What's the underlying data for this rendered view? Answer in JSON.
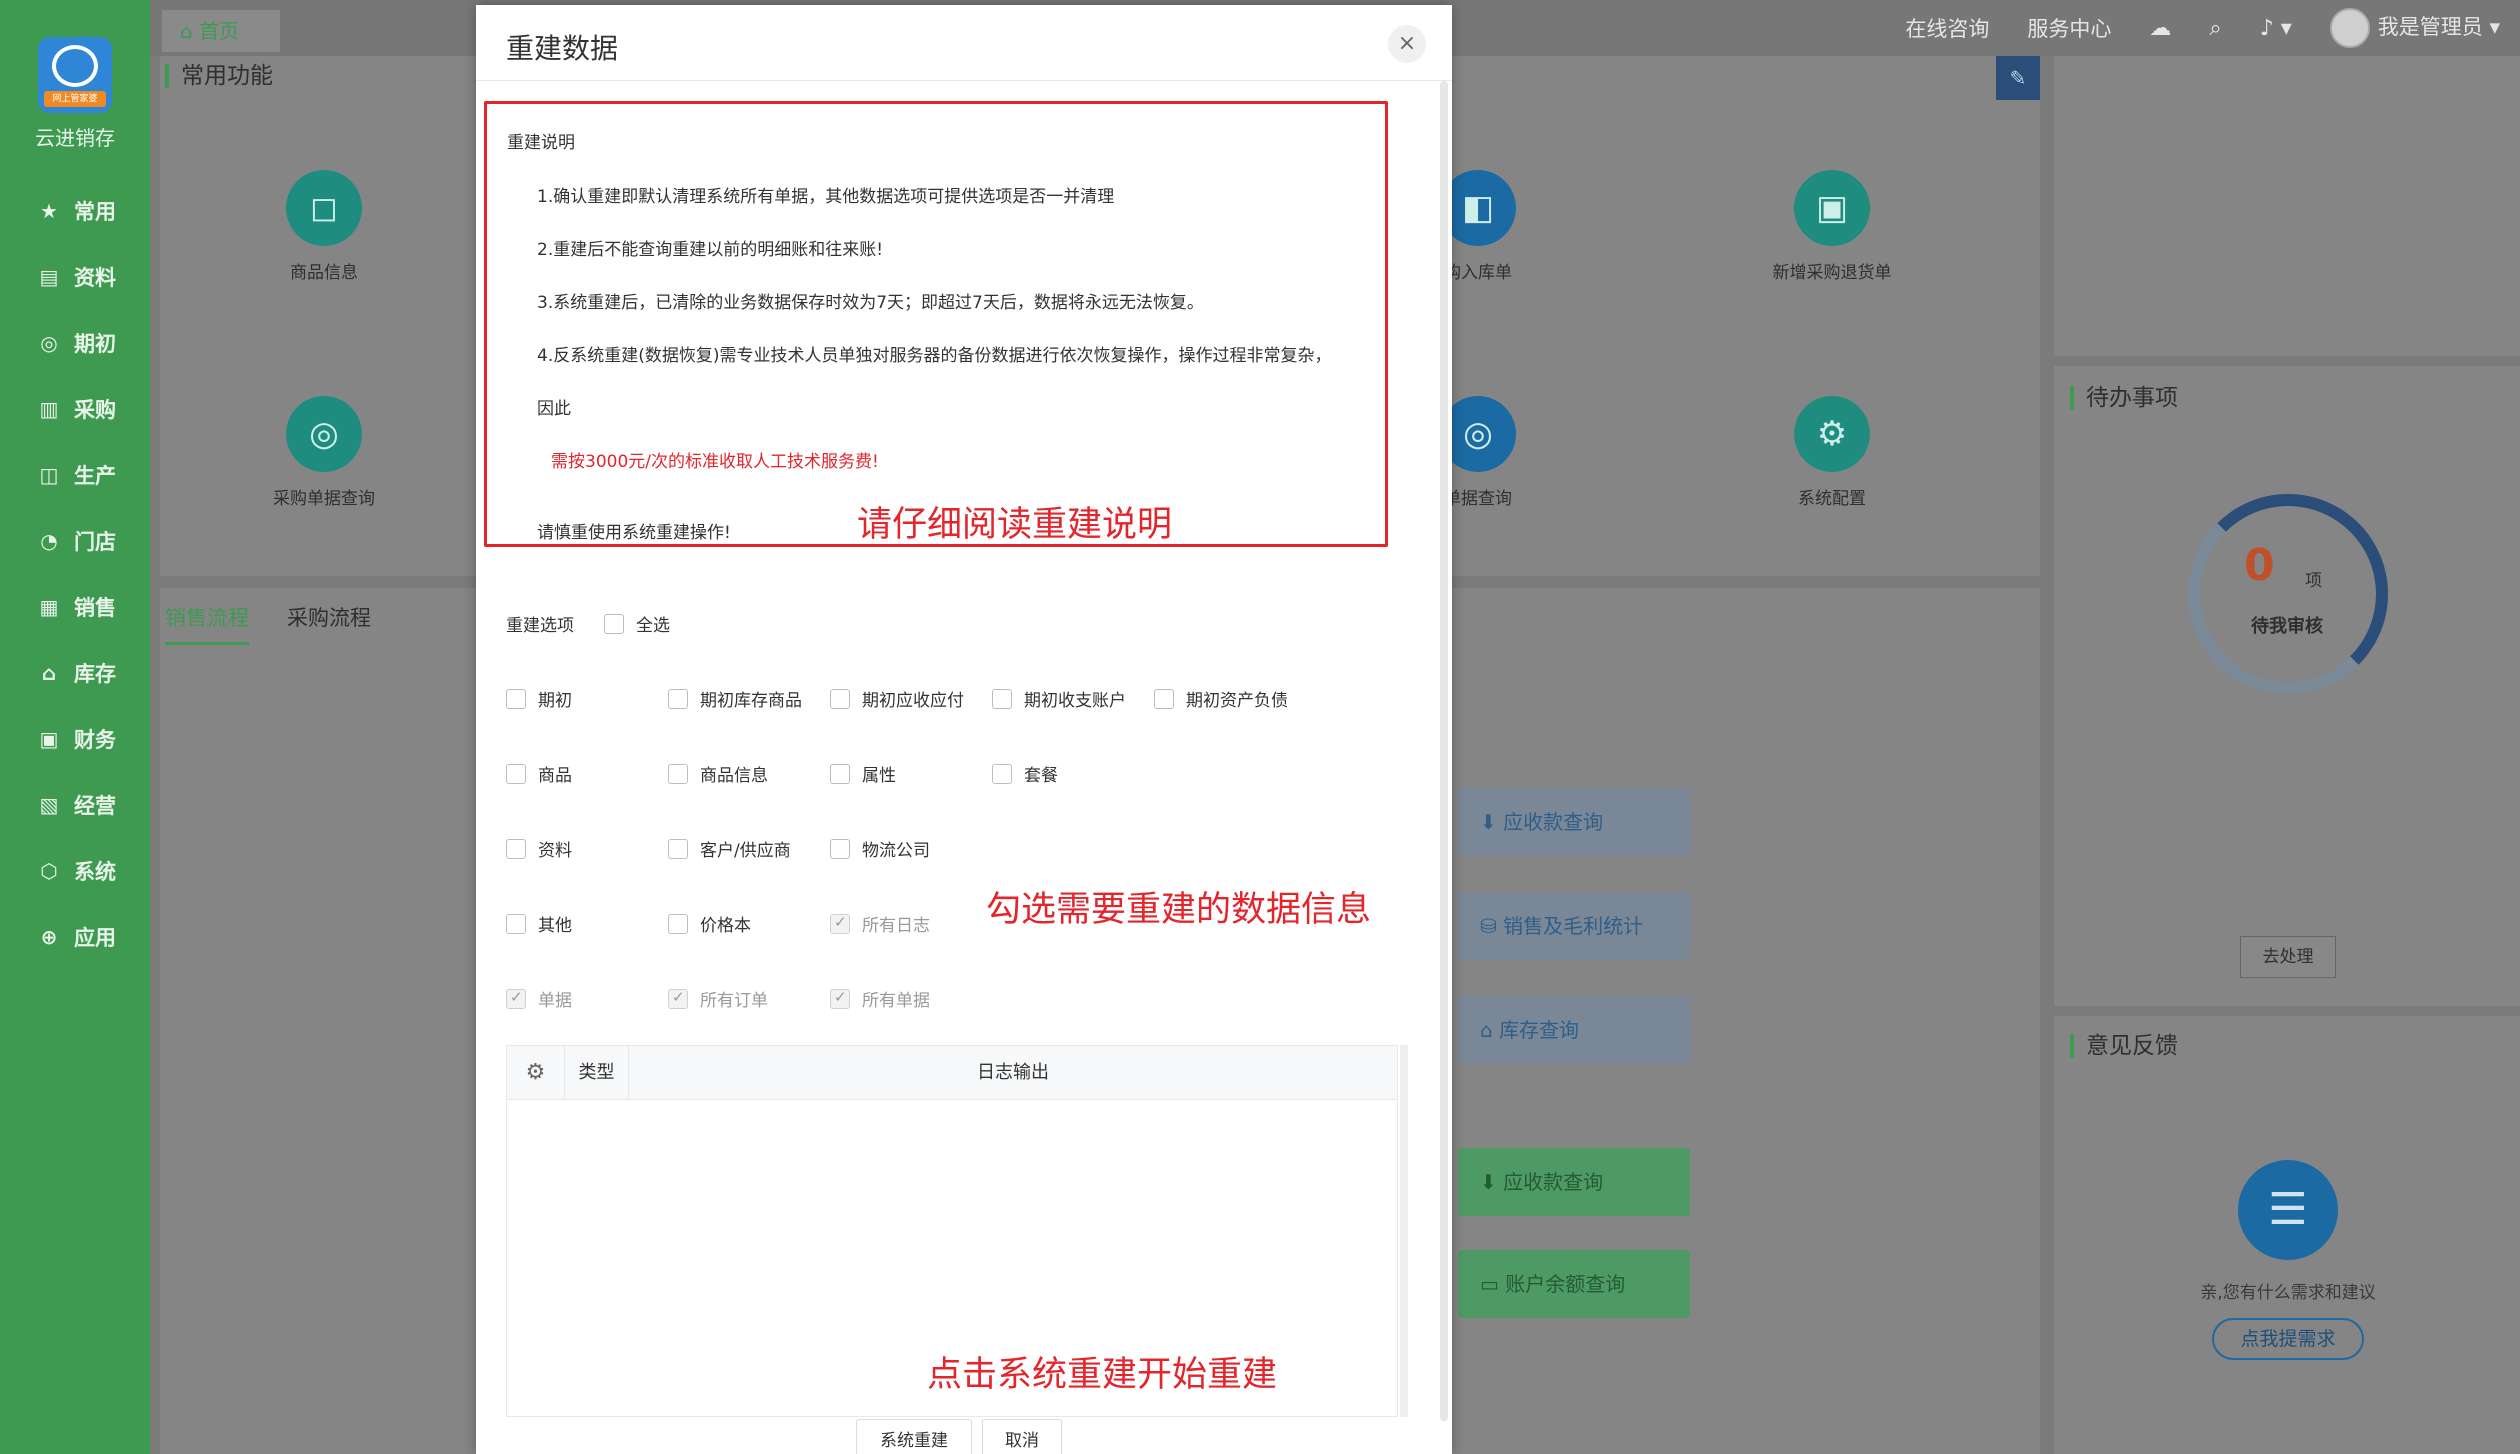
{
  "brand": {
    "name": "云进销存",
    "tag": "网上管家婆"
  },
  "sidebar": {
    "items": [
      {
        "label": "常用",
        "icon": "star-icon"
      },
      {
        "label": "资料",
        "icon": "document-icon"
      },
      {
        "label": "期初",
        "icon": "target-icon"
      },
      {
        "label": "采购",
        "icon": "purchase-icon"
      },
      {
        "label": "生产",
        "icon": "production-icon"
      },
      {
        "label": "门店",
        "icon": "pie-icon"
      },
      {
        "label": "销售",
        "icon": "sales-icon"
      },
      {
        "label": "库存",
        "icon": "warehouse-icon"
      },
      {
        "label": "财务",
        "icon": "finance-icon"
      },
      {
        "label": "经营",
        "icon": "business-icon"
      },
      {
        "label": "系统",
        "icon": "system-icon"
      },
      {
        "label": "应用",
        "icon": "apps-icon"
      }
    ]
  },
  "topbar": {
    "home_tab": "首页",
    "online": "在线咨询",
    "service": "服务中心",
    "user": "我是管理员"
  },
  "background": {
    "common_title": "常用功能",
    "quick": [
      "商品信息",
      "购入库单",
      "新增采购退货单",
      "采购单据查询",
      "单据查询",
      "系统配置"
    ],
    "flow_tabs": [
      "销售流程",
      "采购流程"
    ],
    "flow_buttons_blue": [
      "应收款查询",
      "销售及毛利统计",
      "库存查询"
    ],
    "flow_buttons_green": [
      "应收款查询",
      "账户余额查询"
    ],
    "todo_title": "待办事项",
    "todo_count": "0",
    "todo_unit": "项",
    "todo_label": "待我审核",
    "todo_action": "去处理",
    "feedback_title": "意见反馈",
    "feedback_text": "亲,您有什么需求和建议",
    "feedback_button": "点我提需求"
  },
  "modal": {
    "title": "重建数据",
    "close": "×",
    "notice_title": "重建说明",
    "notice_lines": [
      "1.确认重建即默认清理系统所有单据，其他数据选项可提供选项是否一并清理",
      "2.重建后不能查询重建以前的明细账和往来账!",
      "3.系统重建后，已清除的业务数据保存时效为7天；即超过7天后，数据将永远无法恢复。",
      "4.反系统重建(数据恢复)需专业技术人员单独对服务器的备份数据进行依次恢复操作，操作过程非常复杂，",
      "因此"
    ],
    "notice_fee": "需按3000元/次的标准收取人工技术服务费!",
    "notice_caution": "请慎重使用系统重建操作!",
    "callout_read": "请仔细阅读重建说明",
    "callout_check": "勾选需要重建的数据信息",
    "callout_start": "点击系统重建开始重建",
    "options_label": "重建选项",
    "select_all": "全选",
    "options": [
      {
        "label": "期初",
        "checked": false,
        "disabled": false
      },
      {
        "label": "期初库存商品",
        "checked": false,
        "disabled": false
      },
      {
        "label": "期初应收应付",
        "checked": false,
        "disabled": false
      },
      {
        "label": "期初收支账户",
        "checked": false,
        "disabled": false
      },
      {
        "label": "期初资产负债",
        "checked": false,
        "disabled": false
      },
      {
        "label": "商品",
        "checked": false,
        "disabled": false
      },
      {
        "label": "商品信息",
        "checked": false,
        "disabled": false
      },
      {
        "label": "属性",
        "checked": false,
        "disabled": false
      },
      {
        "label": "套餐",
        "checked": false,
        "disabled": false
      },
      {
        "label": "资料",
        "checked": false,
        "disabled": false
      },
      {
        "label": "客户/供应商",
        "checked": false,
        "disabled": false
      },
      {
        "label": "物流公司",
        "checked": false,
        "disabled": false
      },
      {
        "label": "其他",
        "checked": false,
        "disabled": false
      },
      {
        "label": "价格本",
        "checked": false,
        "disabled": false
      },
      {
        "label": "所有日志",
        "checked": true,
        "disabled": true
      },
      {
        "label": "单据",
        "checked": true,
        "disabled": true
      },
      {
        "label": "所有订单",
        "checked": true,
        "disabled": true
      },
      {
        "label": "所有单据",
        "checked": true,
        "disabled": true
      }
    ],
    "log_columns": {
      "type": "类型",
      "output": "日志输出"
    },
    "buttons": {
      "rebuild": "系统重建",
      "cancel": "取消"
    }
  },
  "colors": {
    "sidebar": "#3f9a51",
    "alert": "#e3252c",
    "primary": "#2f86d6"
  }
}
